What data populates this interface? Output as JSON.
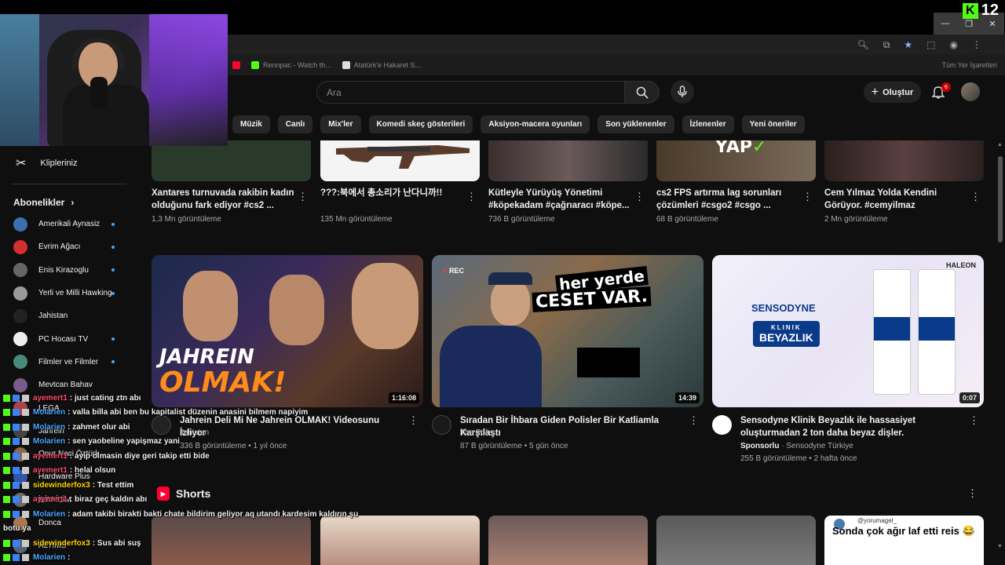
{
  "overlay": {
    "kick_viewers": "12"
  },
  "bookmarks": [
    {
      "label": "Rennpac - Watch th...",
      "color": "#53fc18"
    },
    {
      "label": "Atatürk'e Hakaret S...",
      "color": "#dddddd"
    }
  ],
  "bookmarks_all": "Tüm Yer İşaretleri",
  "search": {
    "placeholder": "Ara"
  },
  "header": {
    "create_label": "Oluştur",
    "notif_count": "6"
  },
  "chips": [
    "Müzik",
    "Canlı",
    "Mix'ler",
    "Komedi skeç gösterileri",
    "Aksiyon-macera oyunları",
    "Son yüklenenler",
    "İzlenenler",
    "Yeni öneriler"
  ],
  "sidebar": {
    "clips_label": "Klipleriniz",
    "subs_title": "Abonelikler",
    "subs": [
      {
        "name": "Amerikali Aynasiz",
        "dot": true,
        "color": "#3b6fb0"
      },
      {
        "name": "Evrim Ağacı",
        "dot": true,
        "color": "#d32f2f"
      },
      {
        "name": "Enis Kirazoglu",
        "dot": true,
        "color": "#666666"
      },
      {
        "name": "Yerli ve Milli Hawking",
        "dot": true,
        "color": "#9a9a9a"
      },
      {
        "name": "Jahistan",
        "dot": false,
        "color": "#222222"
      },
      {
        "name": "PC Hocası TV",
        "dot": true,
        "color": "#eeeeee"
      },
      {
        "name": "Filmler ve Filmler",
        "dot": true,
        "color": "#4a8a7a"
      },
      {
        "name": "Mevtcan Bahav",
        "dot": false,
        "color": "#7a5a8a"
      },
      {
        "name": "LEGA",
        "dot": false,
        "color": "#aa4444"
      },
      {
        "name": "Jahrein",
        "dot": false,
        "color": "#444444"
      },
      {
        "name": "Onur Naci Öztürk",
        "dot": false,
        "color": "#8a6a4a"
      },
      {
        "name": "Hardware Plus",
        "dot": false,
        "color": "#3355aa"
      },
      {
        "name": "İLİM İLİM",
        "dot": false,
        "color": "#6a6a6a"
      },
      {
        "name": "Donca",
        "dot": false,
        "color": "#aa7755"
      },
      {
        "name": "ALTIMS",
        "dot": false,
        "color": "#556677"
      }
    ]
  },
  "row1": [
    {
      "title": "Xantares turnuvada rakibin kadın olduğunu fark ediyor #cs2 ...",
      "meta": "1,3 Mn görüntüleme",
      "thumb": "#3a4a2a"
    },
    {
      "title": "???:북에서 총소리가 난다니까!!",
      "meta": "135 Mn görüntüleme",
      "thumb": "#f0f0f0"
    },
    {
      "title": "Kütleyle Yürüyüş Yönetimi #köpekadam #çağrıaracı #köpe...",
      "meta": "736 B görüntüleme",
      "thumb": "#4a3a3a"
    },
    {
      "title": "cs2 FPS artırma lag sorunları çözümleri #csgo2 #csgo ...",
      "meta": "68 B görüntüleme",
      "thumb": "#5a4a3a"
    },
    {
      "title": "Cem Yılmaz Yolda Kendini Görüyor. #cemyilmaz",
      "meta": "2 Mn görüntüleme",
      "thumb": "#3a2a2a"
    }
  ],
  "videos": [
    {
      "title": "Jahrein Deli Mi Ne Jahrein OLMAK! Videosunu İzliyor",
      "channel": "Jahistan",
      "meta": "336 B görüntüleme • 1 yıl önce",
      "duration": "1:16:08",
      "thumb_text1": "JAHREIN",
      "thumb_text2": "OLMAK!"
    },
    {
      "title": "Sıradan Bir İhbara Giden Polisler Bir Katliamla Karşılaştı",
      "channel": "The Polis",
      "meta": "87 B görüntüleme • 5 gün önce",
      "duration": "14:39",
      "thumb_text1": "her yerde",
      "thumb_text2": "CESET VAR.",
      "rec": "REC"
    },
    {
      "title": "Sensodyne Klinik Beyazlık ile hassasiyet oluşturmadan 2 ton daha beyaz dişler.",
      "channel": "Sensodyne Türkiye",
      "sponsored": "Sponsorlu",
      "meta": "255 B görüntüleme • 2 hafta önce",
      "duration": "0:07",
      "brand1": "SENSODYNE",
      "brand2": "KLINIK",
      "brand3": "BEYAZLIK",
      "haleon": "HALEON"
    }
  ],
  "shorts": {
    "title": "Shorts",
    "items": [
      {
        "color": "#7a5a4a"
      },
      {
        "color": "#c8a890"
      },
      {
        "color": "#8a6a5a"
      },
      {
        "color": "#6a6a6a"
      },
      {
        "color": "#f5f5f5",
        "handle": "@yorumagel_",
        "caption": "Sonda çok ağır laf etti reis 😂"
      }
    ]
  },
  "chat": [
    {
      "user": "ayemert1",
      "color": "#ff4d6d",
      "msg": ": just cating ztn abı"
    },
    {
      "user": "Molarien",
      "color": "#4aa8ff",
      "msg": ": valla billa abi ben bu kapitalist düzenin anasini bilmem napiyim"
    },
    {
      "user": "Molarien",
      "color": "#4aa8ff",
      "msg": ": zahmet olur abi"
    },
    {
      "user": "Molarien",
      "color": "#4aa8ff",
      "msg": ": sen yaobeline yapişmaz yani"
    },
    {
      "user": "ayemert1",
      "color": "#ff4d6d",
      "msg": ": ayip olmasin diye geri takip etti bide"
    },
    {
      "user": "ayemert1",
      "color": "#ff4d6d",
      "msg": ": helal olsun"
    },
    {
      "user": "sidewinderfox3",
      "color": "#ffd700",
      "msg": ": Test ettim"
    },
    {
      "user": "ayemert1",
      "color": "#ff4d6d",
      "msg": ": biraz geç kaldın abı"
    },
    {
      "user": "Molarien",
      "color": "#4aa8ff",
      "msg": ": adam takibi birakti bakti chate bildirim geliyor aq utandı kardesim kaldırın şu"
    },
    {
      "user": "",
      "color": "#ffffff",
      "msg": "botu ya"
    },
    {
      "user": "sidewinderfox3",
      "color": "#ffd700",
      "msg": ": Sus abi suş"
    },
    {
      "user": "Molarien",
      "color": "#4aa8ff",
      "msg": ":"
    }
  ]
}
